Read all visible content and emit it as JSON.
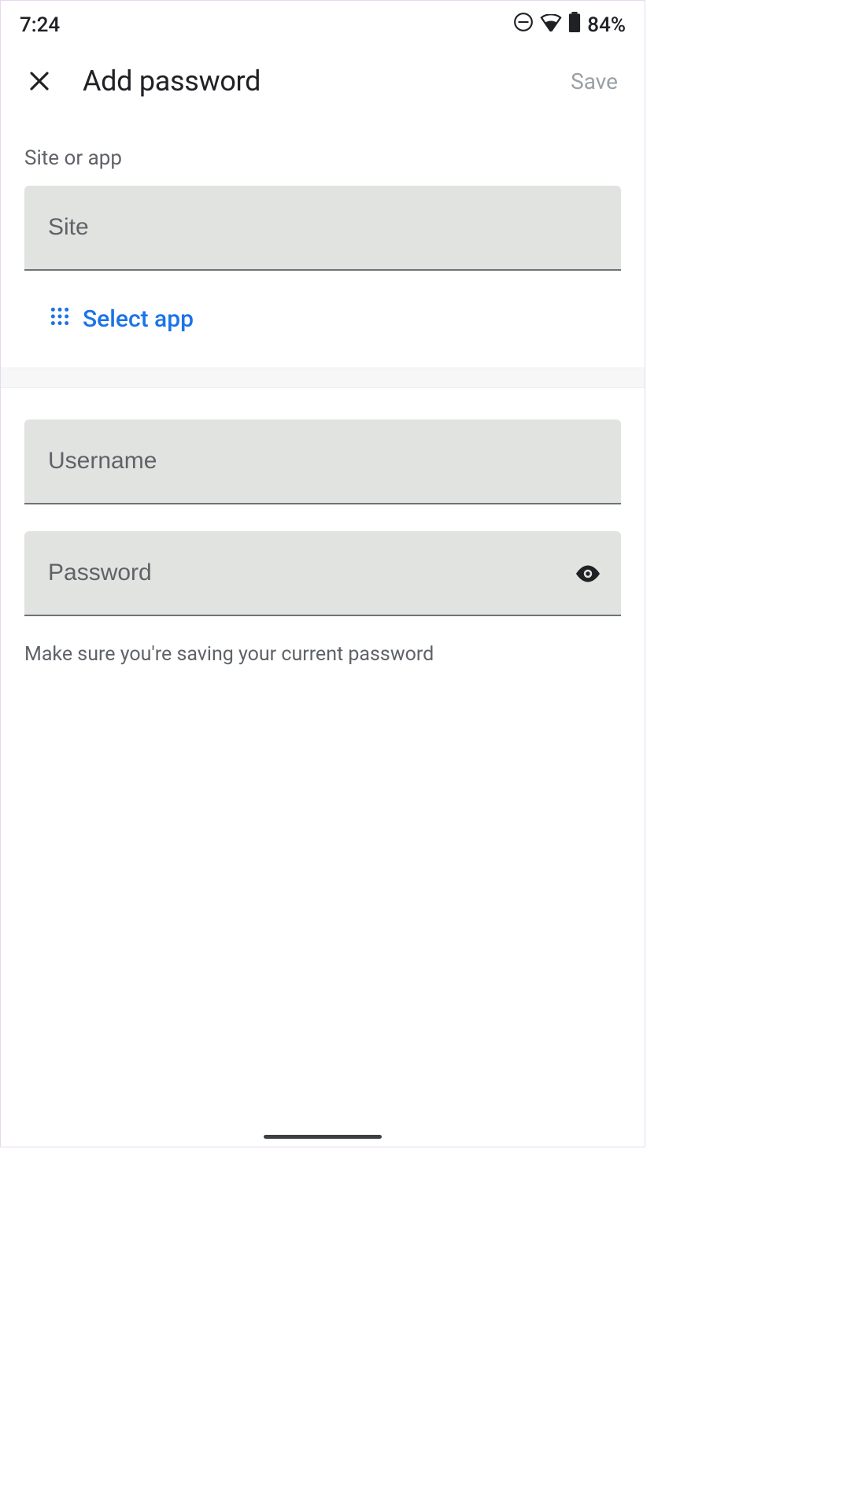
{
  "status_bar": {
    "time": "7:24",
    "battery_text": "84%"
  },
  "header": {
    "title": "Add password",
    "save_label": "Save"
  },
  "site_section": {
    "label": "Site or app",
    "site_placeholder": "Site",
    "select_app_label": "Select app"
  },
  "credentials": {
    "username_placeholder": "Username",
    "password_placeholder": "Password",
    "hint": "Make sure you're saving your current password"
  },
  "colors": {
    "accent": "#1a73e8",
    "input_bg": "#e1e3e0",
    "text_secondary": "#5f6368"
  }
}
